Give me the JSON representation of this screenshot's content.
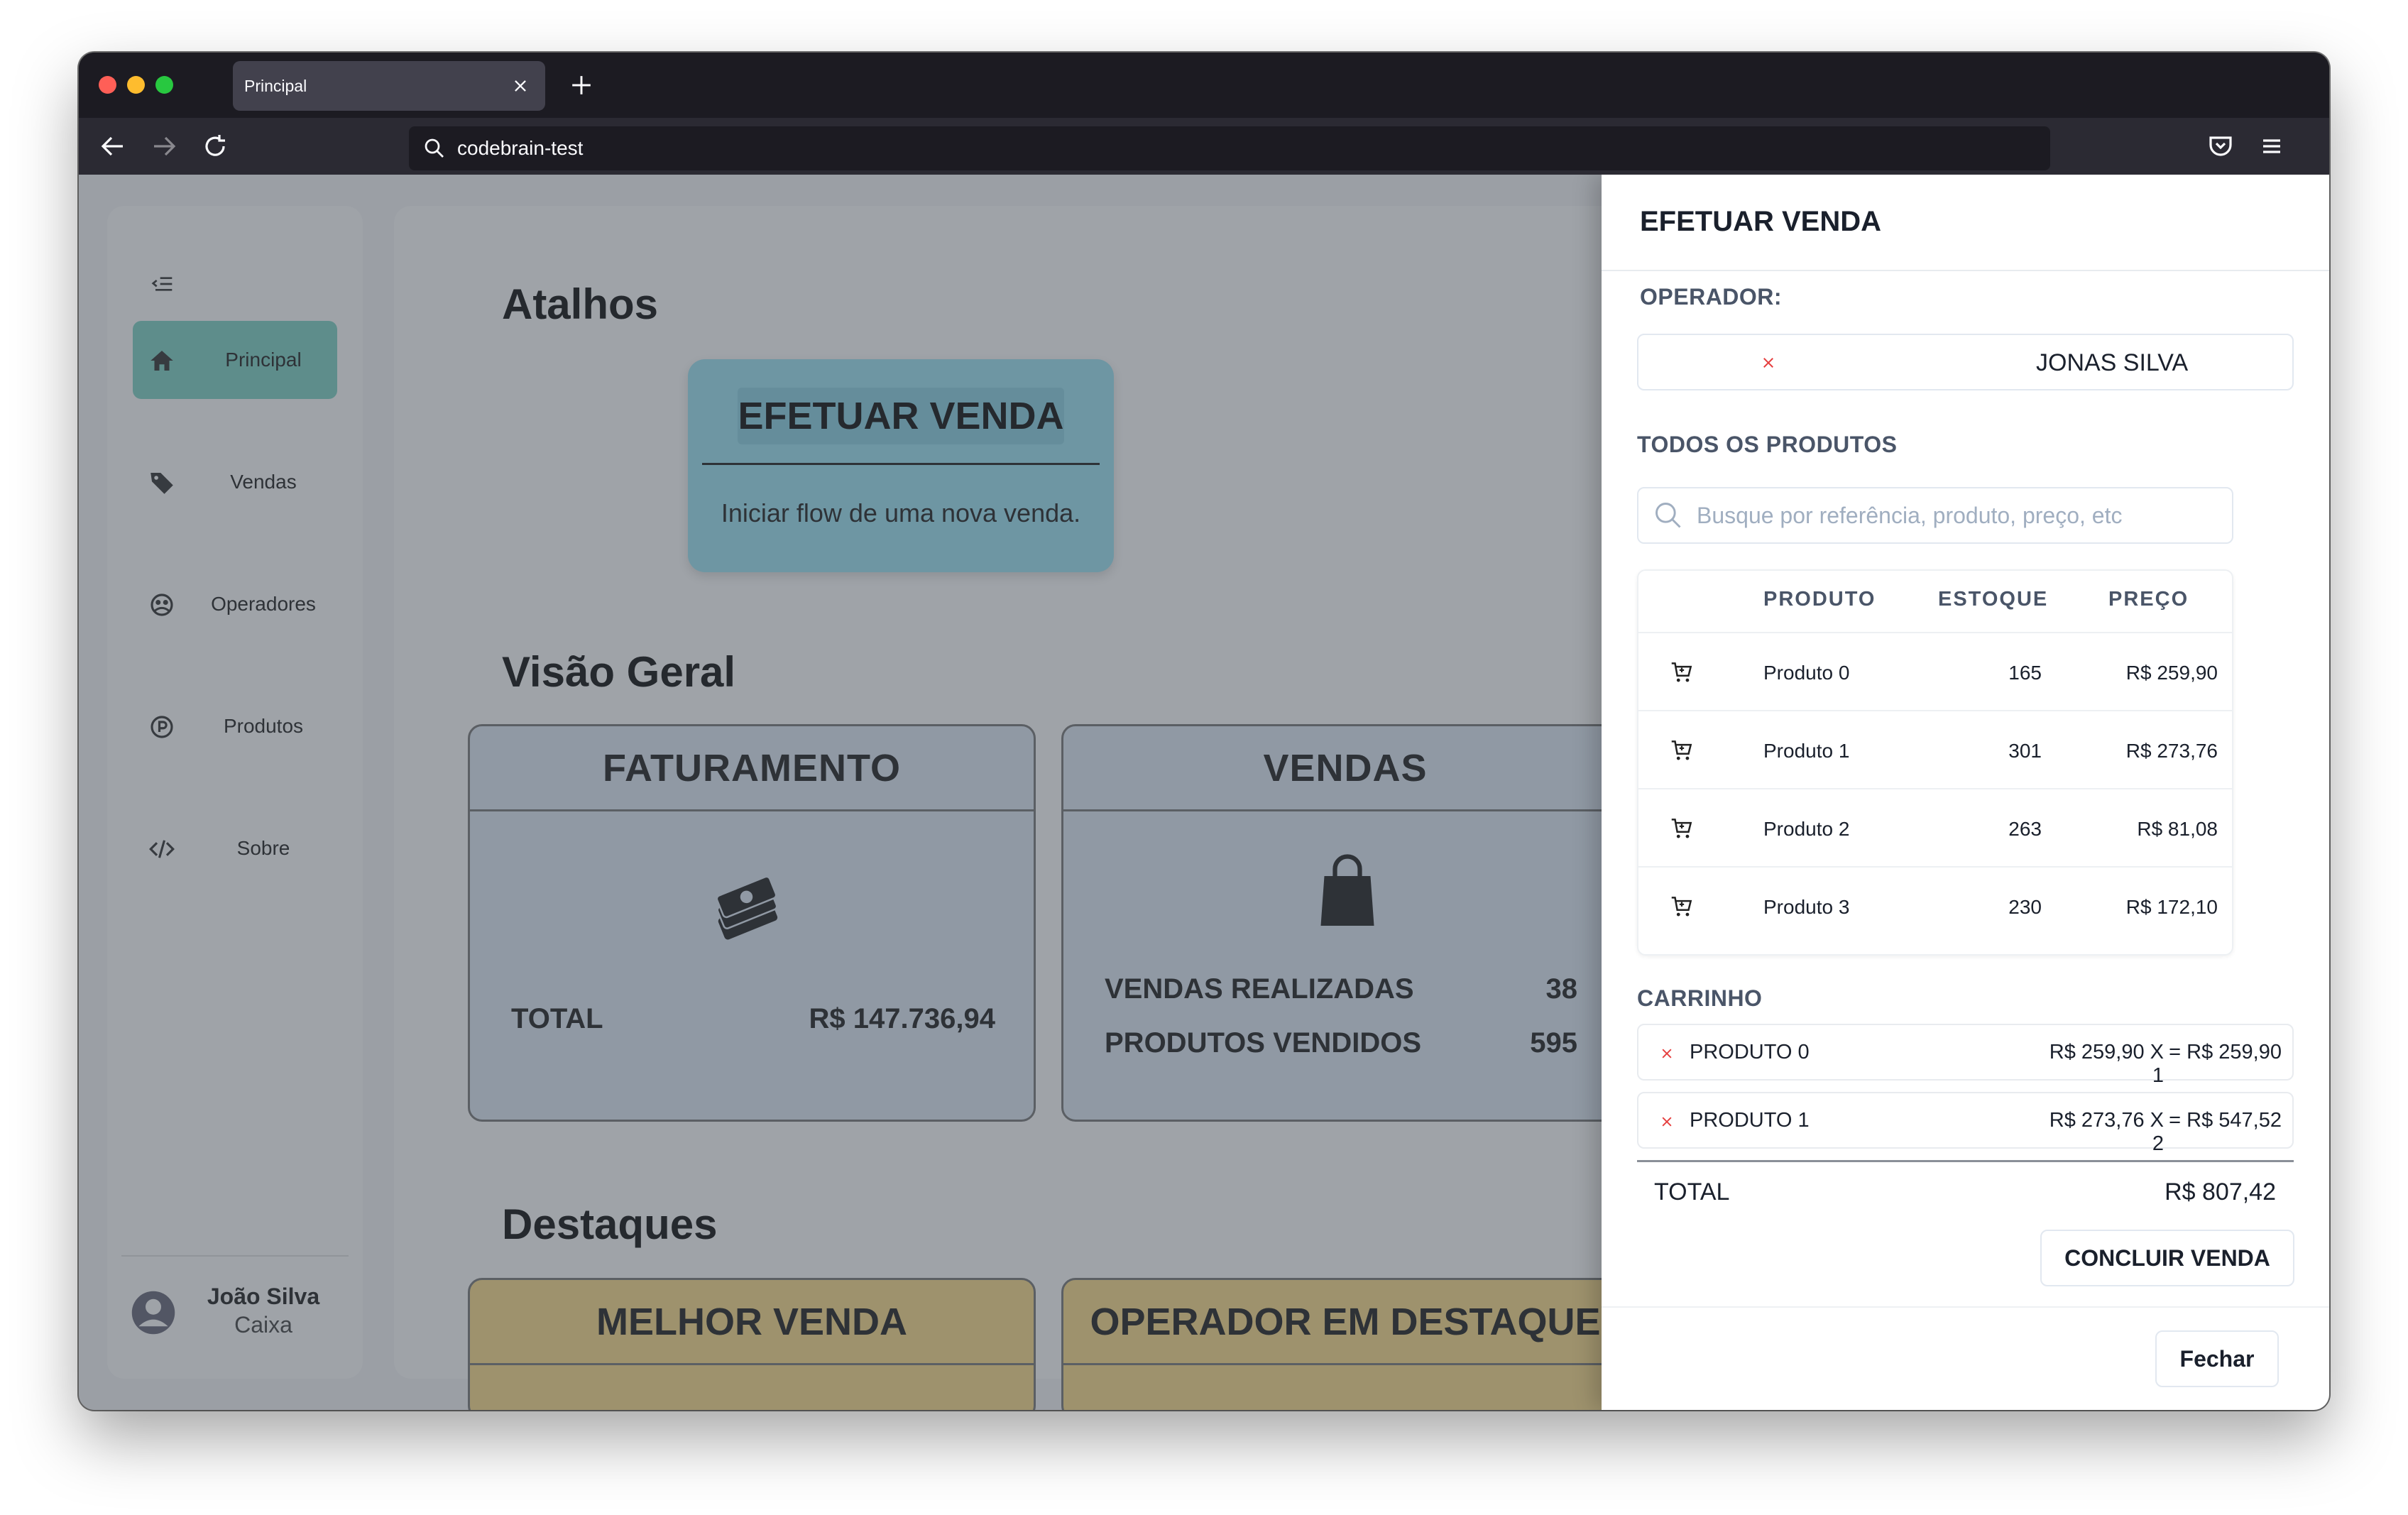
{
  "browser": {
    "tab_title": "Principal",
    "url": "codebrain-test"
  },
  "sidebar": {
    "items": [
      {
        "label": "Principal",
        "icon": "home-icon",
        "active": true
      },
      {
        "label": "Vendas",
        "icon": "tag-icon",
        "active": false
      },
      {
        "label": "Operadores",
        "icon": "operators-icon",
        "active": false
      },
      {
        "label": "Produtos",
        "icon": "product-icon",
        "active": false
      },
      {
        "label": "Sobre",
        "icon": "code-icon",
        "active": false
      }
    ],
    "user": {
      "name": "João Silva",
      "role": "Caixa"
    }
  },
  "main": {
    "shortcuts_title": "Atalhos",
    "shortcut": {
      "title": "EFETUAR VENDA",
      "description": "Iniciar flow de uma nova venda."
    },
    "overview_title": "Visão Geral",
    "faturamento": {
      "title": "FATURAMENTO",
      "total_label": "TOTAL",
      "total_value": "R$ 147.736,94"
    },
    "vendas": {
      "title": "VENDAS",
      "realizadas_label": "VENDAS REALIZADAS",
      "realizadas_value": "38",
      "vendidos_label": "PRODUTOS VENDIDOS",
      "vendidos_value": "595"
    },
    "highlights_title": "Destaques",
    "melhor_venda_title": "MELHOR VENDA",
    "operador_destaque_title": "OPERADOR EM DESTAQUE"
  },
  "drawer": {
    "title": "EFETUAR VENDA",
    "operator_label": "OPERADOR:",
    "operator_name": "JONAS SILVA",
    "products_label": "TODOS OS PRODUTOS",
    "search_placeholder": "Busque por referência, produto, preço, etc",
    "table": {
      "headers": {
        "produto": "PRODUTO",
        "estoque": "ESTOQUE",
        "preco": "PREÇO"
      },
      "rows": [
        {
          "produto": "Produto 0",
          "estoque": "165",
          "preco": "R$ 259,90"
        },
        {
          "produto": "Produto 1",
          "estoque": "301",
          "preco": "R$ 273,76"
        },
        {
          "produto": "Produto 2",
          "estoque": "263",
          "preco": "R$ 81,08"
        },
        {
          "produto": "Produto 3",
          "estoque": "230",
          "preco": "R$ 172,10"
        }
      ]
    },
    "cart_label": "CARRINHO",
    "cart": [
      {
        "name": "PRODUTO 0",
        "calc": "R$ 259,90 X 1",
        "total": "= R$ 259,90"
      },
      {
        "name": "PRODUTO 1",
        "calc": "R$ 273,76 X 2",
        "total": "= R$ 547,52"
      }
    ],
    "total_label": "TOTAL",
    "total_value": "R$ 807,42",
    "conclude_label": "CONCLUIR VENDA",
    "close_label": "Fechar"
  }
}
